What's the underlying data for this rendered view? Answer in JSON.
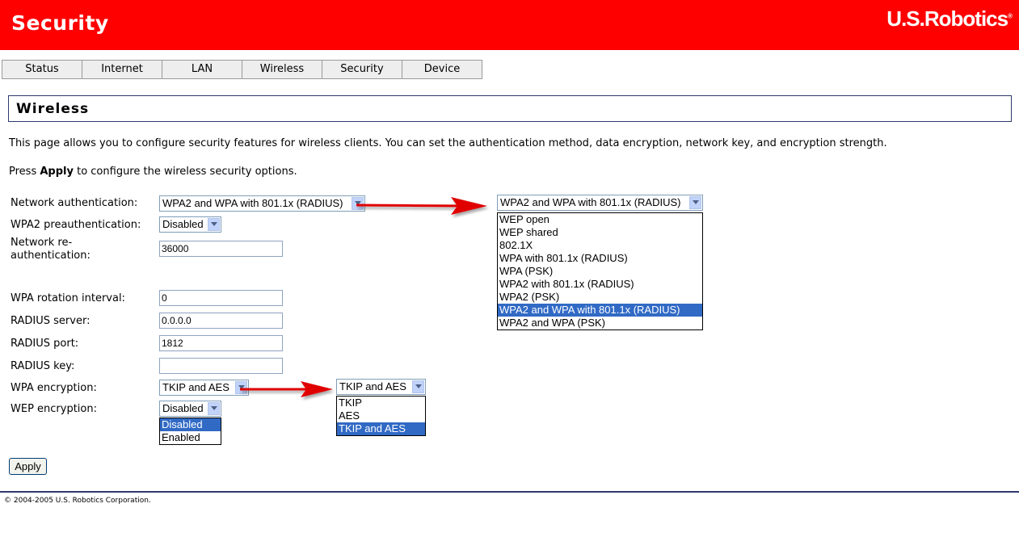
{
  "header": {
    "title": "Security",
    "logo": "U.S.Robotics",
    "logo_mark": "®"
  },
  "tabs": [
    "Status",
    "Internet",
    "LAN",
    "Wireless",
    "Security",
    "Device"
  ],
  "section": {
    "title": "Wireless"
  },
  "intro": "This page allows you to configure security features for wireless clients. You can set the authentication method, data encryption, network key, and encryption strength.",
  "press": {
    "prefix": "Press ",
    "bold": "Apply",
    "suffix": " to configure the wireless security options."
  },
  "form": {
    "network_auth": {
      "label": "Network authentication:",
      "value": "WPA2 and WPA with 801.1x (RADIUS)"
    },
    "wpa2_preauth": {
      "label": "WPA2 preauthentication:",
      "value": "Disabled"
    },
    "reauth": {
      "label": "Network re-authentication:",
      "value": "36000"
    },
    "rotation": {
      "label": "WPA rotation interval:",
      "value": "0"
    },
    "radius_server": {
      "label": "RADIUS server:",
      "value": "0.0.0.0"
    },
    "radius_port": {
      "label": "RADIUS port:",
      "value": "1812"
    },
    "radius_key": {
      "label": "RADIUS key:",
      "value": ""
    },
    "wpa_enc": {
      "label": "WPA encryption:",
      "value": "TKIP and AES"
    },
    "wep_enc": {
      "label": "WEP encryption:",
      "value": "Disabled"
    }
  },
  "wep_list": [
    "Disabled",
    "Enabled"
  ],
  "auth_dropdown": {
    "value": "WPA2 and WPA with 801.1x (RADIUS)",
    "options": [
      "WEP open",
      "WEP shared",
      "802.1X",
      "WPA with 801.1x (RADIUS)",
      "WPA (PSK)",
      "WPA2 with 801.1x (RADIUS)",
      "WPA2 (PSK)",
      "WPA2 and WPA with 801.1x (RADIUS)",
      "WPA2 and WPA (PSK)"
    ]
  },
  "enc_dropdown": {
    "value": "TKIP and AES",
    "options": [
      "TKIP",
      "AES",
      "TKIP and AES"
    ]
  },
  "apply_label": "Apply",
  "footer": "© 2004-2005 U.S. Robotics Corporation.",
  "colors": {
    "header": "#ff0000",
    "selection": "#316ac5",
    "arrow": "#e00000"
  }
}
